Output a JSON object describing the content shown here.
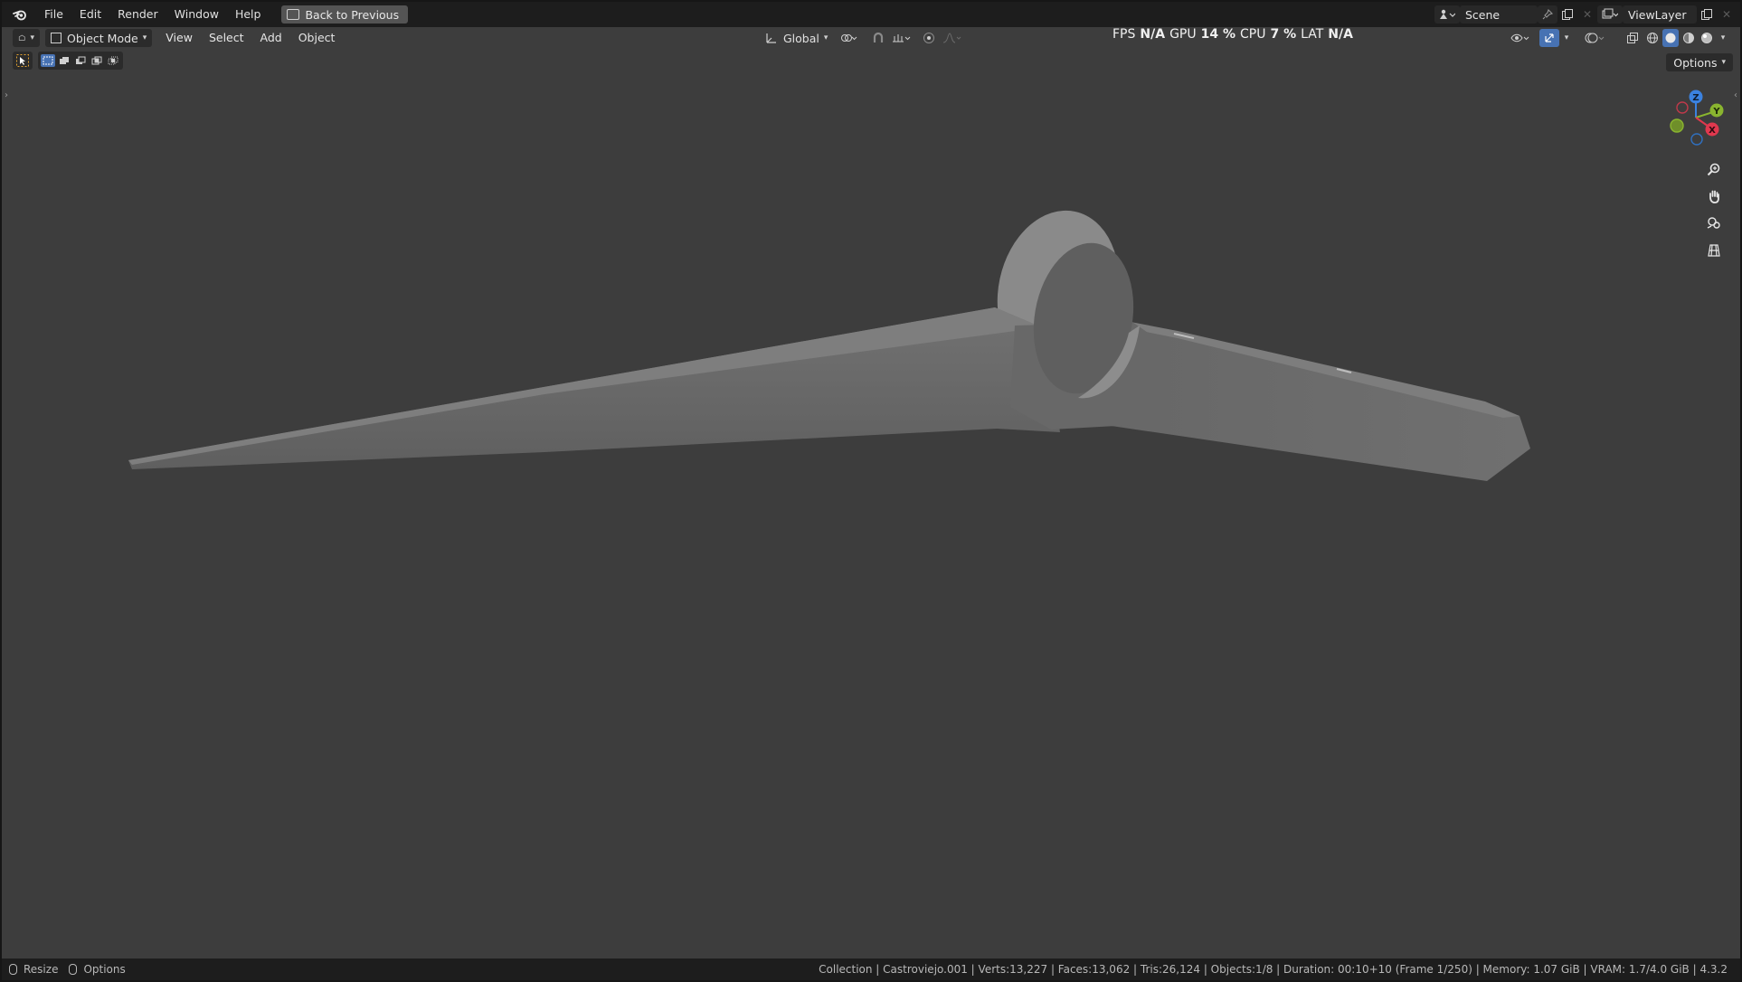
{
  "menubar": {
    "items": [
      "File",
      "Edit",
      "Render",
      "Window",
      "Help"
    ],
    "back_button": "Back to Previous",
    "scene": "Scene",
    "view_layer": "ViewLayer"
  },
  "viewport_header": {
    "mode": "Object Mode",
    "menus": [
      "View",
      "Select",
      "Add",
      "Object"
    ],
    "orientation": "Global",
    "options": "Options"
  },
  "stats": {
    "fps_label": "FPS",
    "fps_value": "N/A",
    "gpu_label": "GPU",
    "gpu_value": "14 %",
    "cpu_label": "CPU",
    "cpu_value": "7 %",
    "lat_label": "LAT",
    "lat_value": "N/A"
  },
  "gizmo": {
    "z": "Z",
    "y": "Y",
    "x": "X"
  },
  "statusbar": {
    "resize": "Resize",
    "options": "Options",
    "info": "Collection | Castroviejo.001 | Verts:13,227 | Faces:13,062 | Tris:26,124 | Objects:1/8 | Duration: 00:10+10 (Frame 1/250) | Memory: 1.07 GiB | VRAM: 1.7/4.0 GiB | 4.3.2"
  },
  "colors": {
    "viewport_bg": "#3d3d3d",
    "active_blue": "#4772b3",
    "axis_x": "#e0384e",
    "axis_y": "#8ab52f",
    "axis_z": "#3b82e0"
  }
}
